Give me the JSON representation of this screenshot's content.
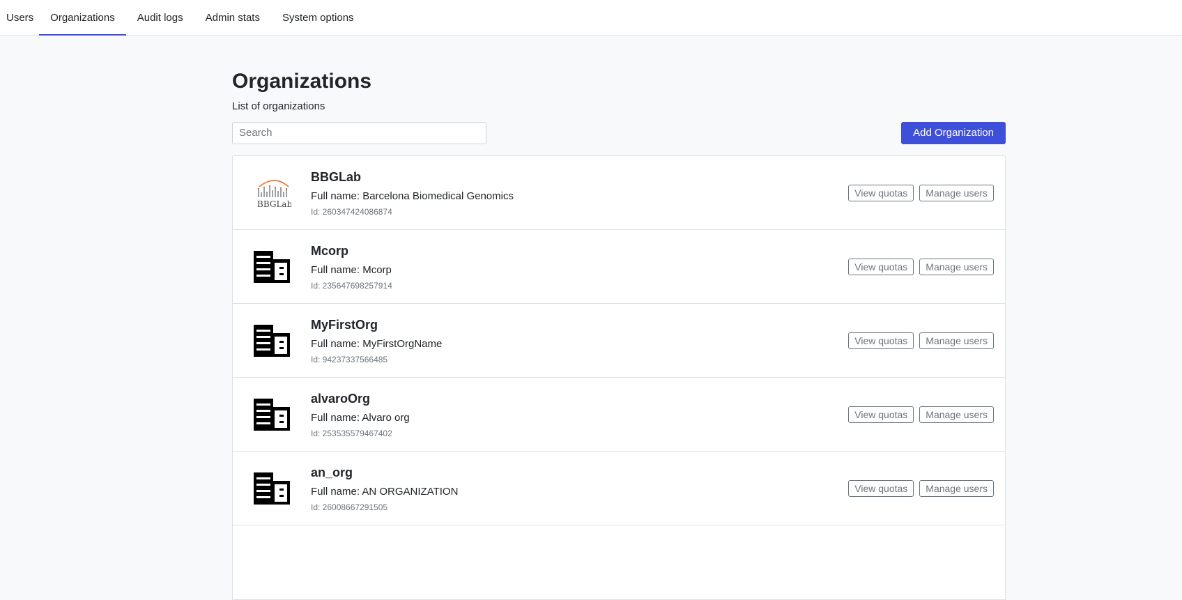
{
  "nav": {
    "tabs": [
      {
        "label": "Users",
        "active": false
      },
      {
        "label": "Organizations",
        "active": true
      },
      {
        "label": "Audit logs",
        "active": false
      },
      {
        "label": "Admin stats",
        "active": false
      },
      {
        "label": "System options",
        "active": false
      }
    ]
  },
  "page": {
    "title": "Organizations",
    "subtitle": "List of organizations"
  },
  "search": {
    "placeholder": "Search",
    "value": ""
  },
  "add_button": {
    "label": "Add Organization"
  },
  "colors": {
    "accent": "#3e4fd9",
    "logo_orange": "#e8743b"
  },
  "actions": {
    "view_quotas": "View quotas",
    "manage_users": "Manage users"
  },
  "organizations": [
    {
      "name": "BBGLab",
      "full_name": "Full name: Barcelona Biomedical Genomics",
      "id": "Id: 260347424086874",
      "logo": "bbglab-logo",
      "logo_text": "BBGLab"
    },
    {
      "name": "Mcorp",
      "full_name": "Full name: Mcorp",
      "id": "Id: 235647698257914",
      "logo": "building-icon"
    },
    {
      "name": "MyFirstOrg",
      "full_name": "Full name: MyFirstOrgName",
      "id": "Id: 94237337566485",
      "logo": "building-icon"
    },
    {
      "name": "alvaroOrg",
      "full_name": "Full name: Alvaro org",
      "id": "Id: 253535579467402",
      "logo": "building-icon"
    },
    {
      "name": "an_org",
      "full_name": "Full name: AN ORGANIZATION",
      "id": "Id: 26008667291505",
      "logo": "building-icon"
    }
  ]
}
